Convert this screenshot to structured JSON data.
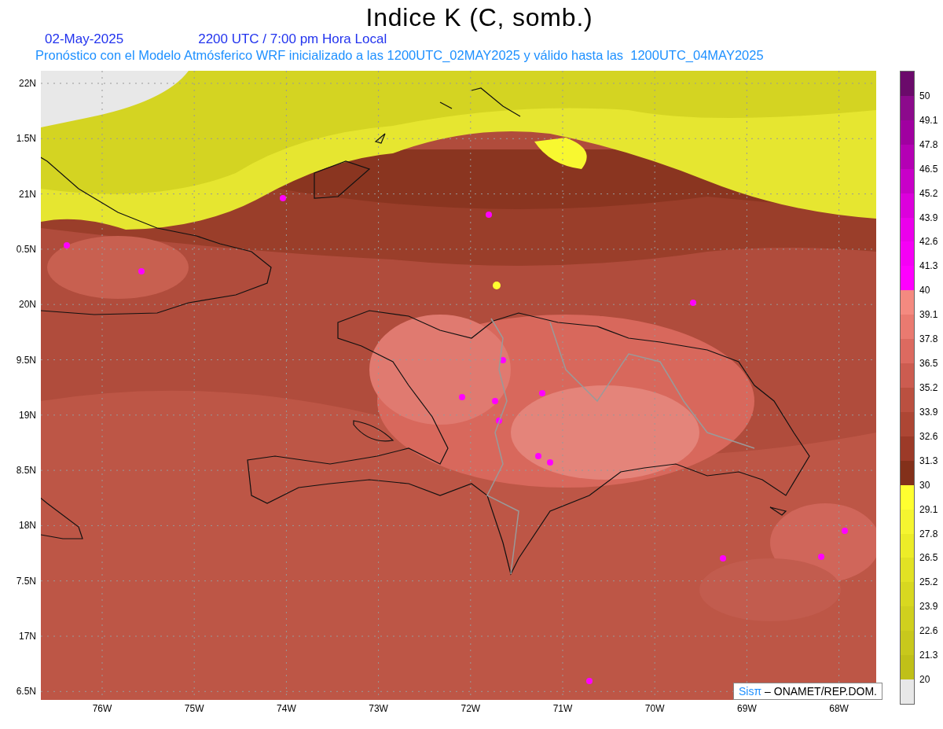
{
  "title": "Indice K (C, somb.)",
  "date": "02-May-2025",
  "time": "2200 UTC / 7:00 pm Hora Local",
  "subtitle": "Pronóstico con el Modelo Atmósferico WRF inicializado a las 1200UTC_02MAY2025 y válido hasta las  1200UTC_04MAY2025",
  "y_axis": [
    "22N",
    "1.5N",
    "21N",
    "0.5N",
    "20N",
    "9.5N",
    "19N",
    "8.5N",
    "18N",
    "7.5N",
    "17N",
    "6.5N"
  ],
  "x_axis": [
    "76W",
    "75W",
    "74W",
    "73W",
    "72W",
    "71W",
    "70W",
    "69W",
    "68W"
  ],
  "credit": {
    "logo": "Sisπ",
    "text": "– ONAMET/REP.DOM."
  },
  "legend": [
    {
      "color": "#6b0a6b",
      "label": "50"
    },
    {
      "color": "#8c0a8c",
      "label": "49.1"
    },
    {
      "color": "#a000a0",
      "label": "47.8"
    },
    {
      "color": "#b400b4",
      "label": "46.5"
    },
    {
      "color": "#c800c8",
      "label": "45.2"
    },
    {
      "color": "#dc00dc",
      "label": "43.9"
    },
    {
      "color": "#eb00eb",
      "label": "42.6"
    },
    {
      "color": "#f500f5",
      "label": "41.3"
    },
    {
      "color": "#ff00ff",
      "label": "40"
    },
    {
      "color": "#f48a80",
      "label": "39.1"
    },
    {
      "color": "#ea7a70",
      "label": "37.8"
    },
    {
      "color": "#dc6a60",
      "label": "36.5"
    },
    {
      "color": "#cc5c50",
      "label": "35.2"
    },
    {
      "color": "#bb5040",
      "label": "33.9"
    },
    {
      "color": "#ad4634",
      "label": "32.6"
    },
    {
      "color": "#9c3a28",
      "label": "31.3"
    },
    {
      "color": "#83301a",
      "label": "30"
    },
    {
      "color": "#ffff30",
      "label": "29.1"
    },
    {
      "color": "#f5f530",
      "label": "27.8"
    },
    {
      "color": "#ecec28",
      "label": "26.5"
    },
    {
      "color": "#e2e224",
      "label": "25.2"
    },
    {
      "color": "#d8d820",
      "label": "23.9"
    },
    {
      "color": "#d0d01e",
      "label": "22.6"
    },
    {
      "color": "#c8c81c",
      "label": "21.3"
    },
    {
      "color": "#c0c018",
      "label": "20"
    },
    {
      "color": "#e8e8e8"
    }
  ]
}
